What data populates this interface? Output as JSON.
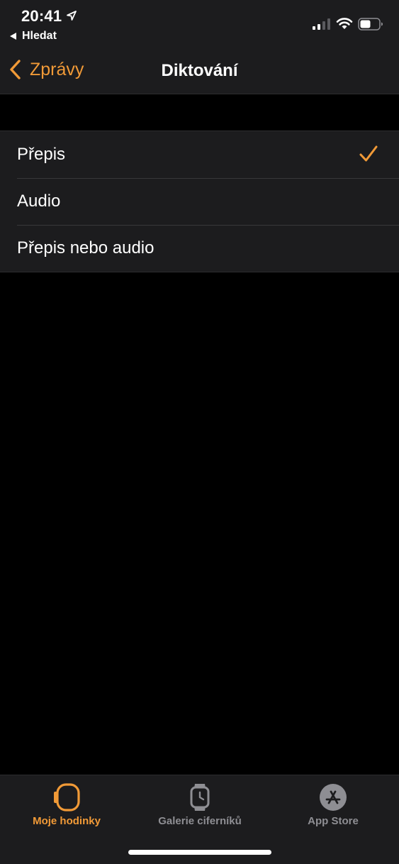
{
  "status": {
    "time": "20:41",
    "back_app": "Hledat"
  },
  "nav": {
    "back_label": "Zprávy",
    "title": "Diktování"
  },
  "options": [
    {
      "label": "Přepis",
      "selected": true
    },
    {
      "label": "Audio",
      "selected": false
    },
    {
      "label": "Přepis nebo audio",
      "selected": false
    }
  ],
  "tabs": [
    {
      "label": "Moje hodinky",
      "icon": "watch-icon",
      "active": true
    },
    {
      "label": "Galerie ciferníků",
      "icon": "watch-face-icon",
      "active": false
    },
    {
      "label": "App Store",
      "icon": "app-store-icon",
      "active": false
    }
  ],
  "colors": {
    "accent": "#f19a37",
    "background": "#000000",
    "surface": "#1c1c1e",
    "inactive": "#8e8e93"
  }
}
